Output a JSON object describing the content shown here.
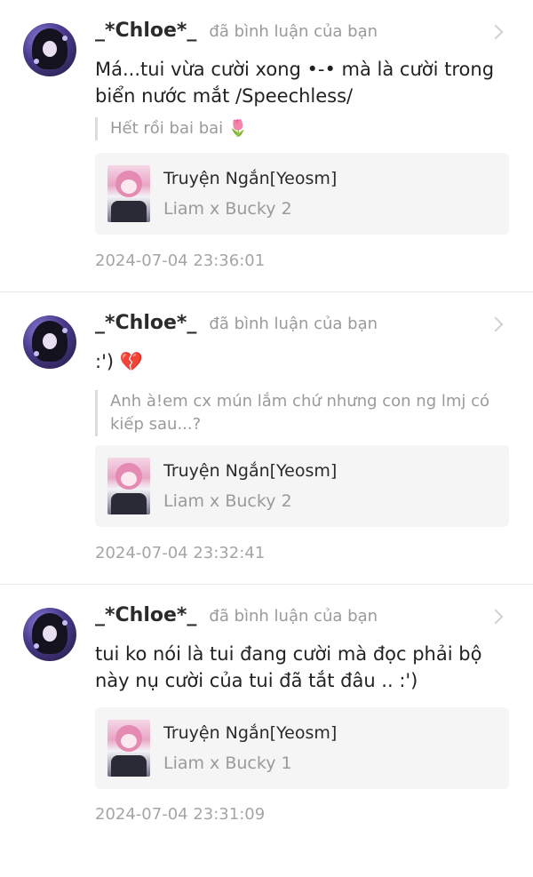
{
  "notifications": [
    {
      "username": "_*Chloe*_",
      "action": "đã bình luận của bạn",
      "comment": "Má...tui vừa cười xong •-• mà là cười trong biển nước mắt /Speechless/",
      "quote": "Hết rồi bai bai 🌷",
      "story_title": "Truyện Ngắn[Yeosm]",
      "chapter": "Liam x Bucky 2",
      "timestamp": "2024-07-04 23:36:01"
    },
    {
      "username": "_*Chloe*_",
      "action": "đã bình luận của bạn",
      "comment": ":') 💔",
      "quote": "Anh à!em cx mún lắm chứ nhưng con ng lmj có kiếp sau...?",
      "story_title": "Truyện Ngắn[Yeosm]",
      "chapter": "Liam x Bucky 2",
      "timestamp": "2024-07-04 23:32:41"
    },
    {
      "username": "_*Chloe*_",
      "action": "đã bình luận của bạn",
      "comment": "tui ko nói là tui đang cười mà đọc phải bộ này nụ cười của tui đã tắt đâu .. :')",
      "story_title": "Truyện Ngắn[Yeosm]",
      "chapter": "Liam x Bucky 1",
      "timestamp": "2024-07-04 23:31:09"
    }
  ],
  "icons": {
    "chevron": "chevron-right-icon",
    "avatar": "user-avatar"
  },
  "colors": {
    "muted_text": "#9a9a9a",
    "card_bg": "#f5f5f6",
    "divider": "#e8e8e8"
  }
}
